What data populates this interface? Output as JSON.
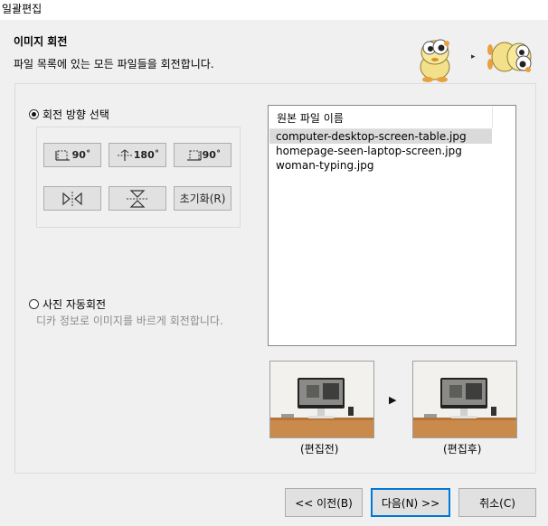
{
  "window": {
    "title": "일괄편집"
  },
  "header": {
    "title": "이미지 회전",
    "subtitle": "파일 목록에 있는 모든 파일들을 회전합니다."
  },
  "rotation": {
    "manual_label": "회전 방향 선택",
    "manual_selected": true,
    "buttons": {
      "rotate_left": "90˚",
      "rotate_180": "180˚",
      "rotate_right": "90˚",
      "reset": "초기화(R)"
    },
    "auto_label": "사진 자동회전",
    "auto_hint": "디카 정보로 이미지를 바르게 회전합니다."
  },
  "filelist": {
    "header": "원본 파일 이름",
    "selected_index": 0,
    "items": [
      "computer-desktop-screen-table.jpg",
      "homepage-seen-laptop-screen.jpg",
      "woman-typing.jpg"
    ]
  },
  "preview": {
    "before_label": "(편집전)",
    "after_label": "(편집후)"
  },
  "footer": {
    "prev": "<< 이전(B)",
    "next": "다음(N) >>",
    "cancel": "취소(C)"
  },
  "colors": {
    "accent": "#0078d7",
    "selection": "#dadada",
    "hint_text": "#8c8c8c"
  }
}
